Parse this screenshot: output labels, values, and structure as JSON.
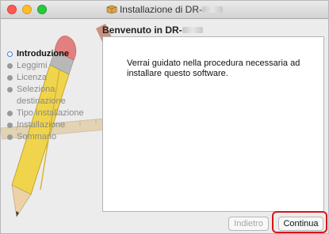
{
  "window": {
    "title_prefix": "Installazione di DR-",
    "title_redacted": "W160",
    "header_prefix": "Benvenuto in DR-",
    "header_redacted": "W160"
  },
  "sidebar": {
    "items": [
      {
        "label": "Introduzione",
        "state": "active"
      },
      {
        "label": "Leggimi",
        "state": "inactive"
      },
      {
        "label": "Licenza",
        "state": "inactive"
      },
      {
        "label": "Seleziona destinazione",
        "state": "inactive"
      },
      {
        "label": "Tipo installazione",
        "state": "inactive"
      },
      {
        "label": "Installazione",
        "state": "inactive"
      },
      {
        "label": "Sommario",
        "state": "inactive"
      }
    ]
  },
  "content": {
    "message": "Verrai guidato nella procedura necessaria ad installare questo software."
  },
  "buttons": {
    "back_label": "Indietro",
    "continue_label": "Continua"
  },
  "colors": {
    "active_step": "#3d7fd9",
    "highlight": "#d8141a"
  }
}
